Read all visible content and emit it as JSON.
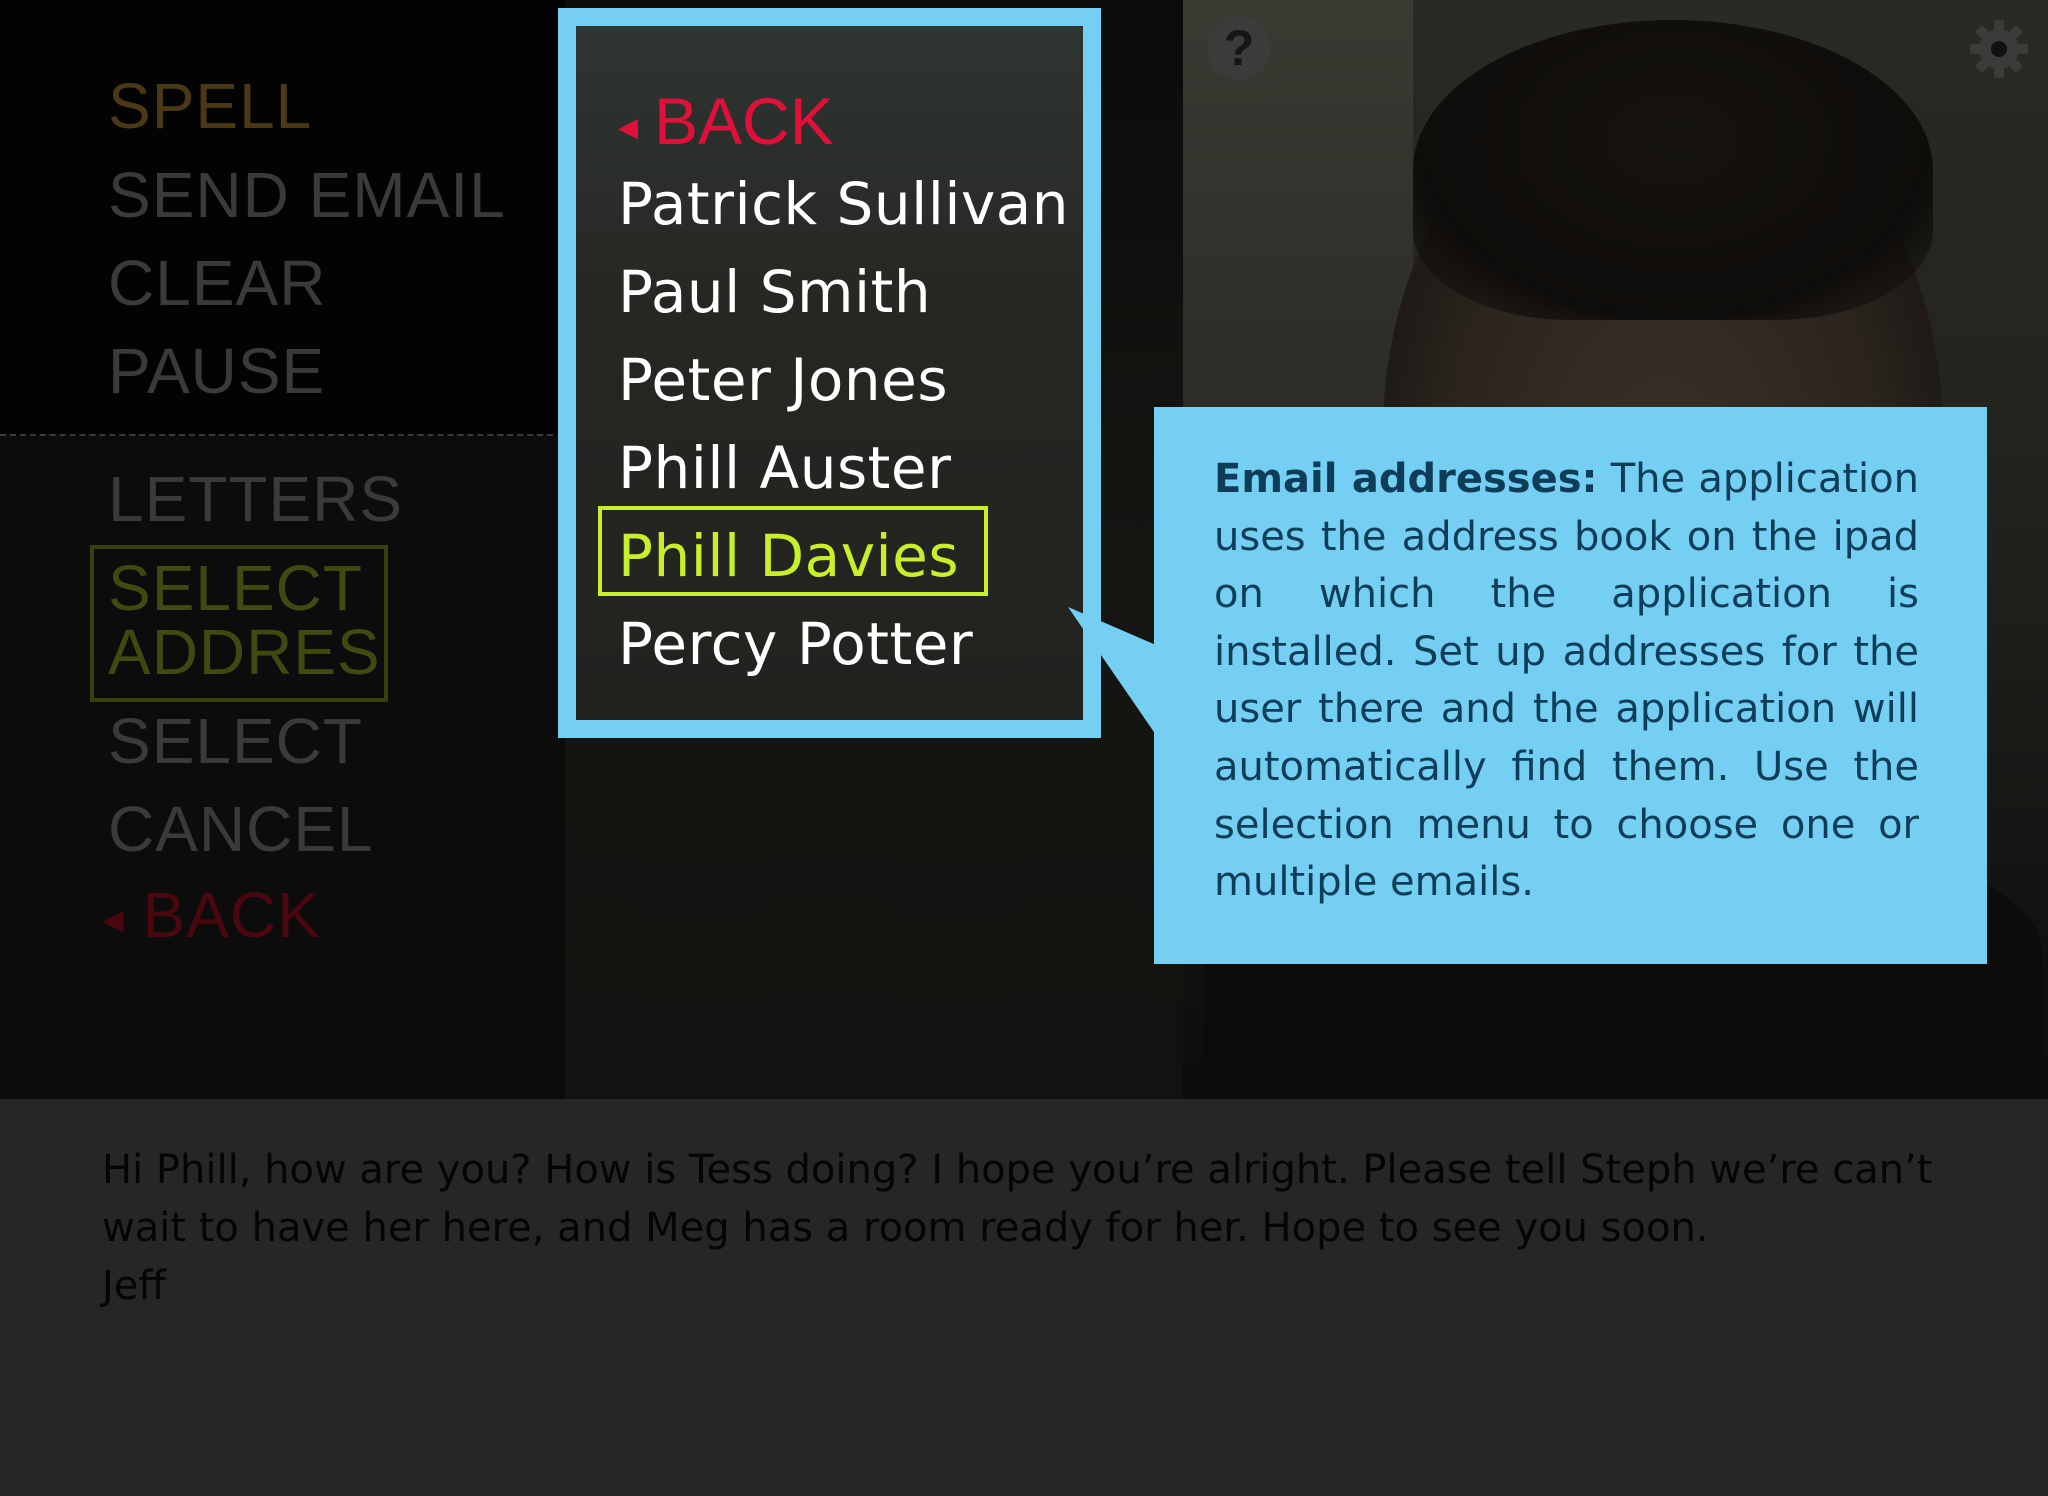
{
  "side_menu": {
    "top_items": [
      "SPELL",
      "SEND EMAIL",
      "CLEAR",
      "PAUSE"
    ],
    "bottom_items": {
      "letters": "LETTERS",
      "select_address_line1": "SELECT",
      "select_address_line2": "ADDRES",
      "select": "SELECT",
      "cancel": "CANCEL",
      "back": "BACK"
    }
  },
  "icons": {
    "help": "?",
    "help_name": "help-icon",
    "settings_name": "gear-icon"
  },
  "contact_picker": {
    "back_label": "BACK",
    "contacts": [
      "Patrick Sullivan",
      "Paul Smith",
      "Peter Jones",
      "Phill Auster",
      "Phill Davies",
      "Percy Potter"
    ],
    "selected_index": 4
  },
  "callout": {
    "heading": "Email addresses:",
    "body": " The application uses the address book on the ipad on which the application is installed. Set up addresses for the user there and the application will automatically find them.  Use the selection menu to choose one or multiple emails."
  },
  "message": {
    "text": "Hi Phill, how are you? How is Tess doing? I hope you’re alright. Please tell Steph we’re can’t wait to have her here, and Meg has a room ready for her. Hope to see you soon.\nJeff"
  },
  "colors": {
    "picker_border": "#74cff2",
    "callout_bg": "#74cff2",
    "highlight": "#c8f02a",
    "back_red": "#e0103a"
  }
}
